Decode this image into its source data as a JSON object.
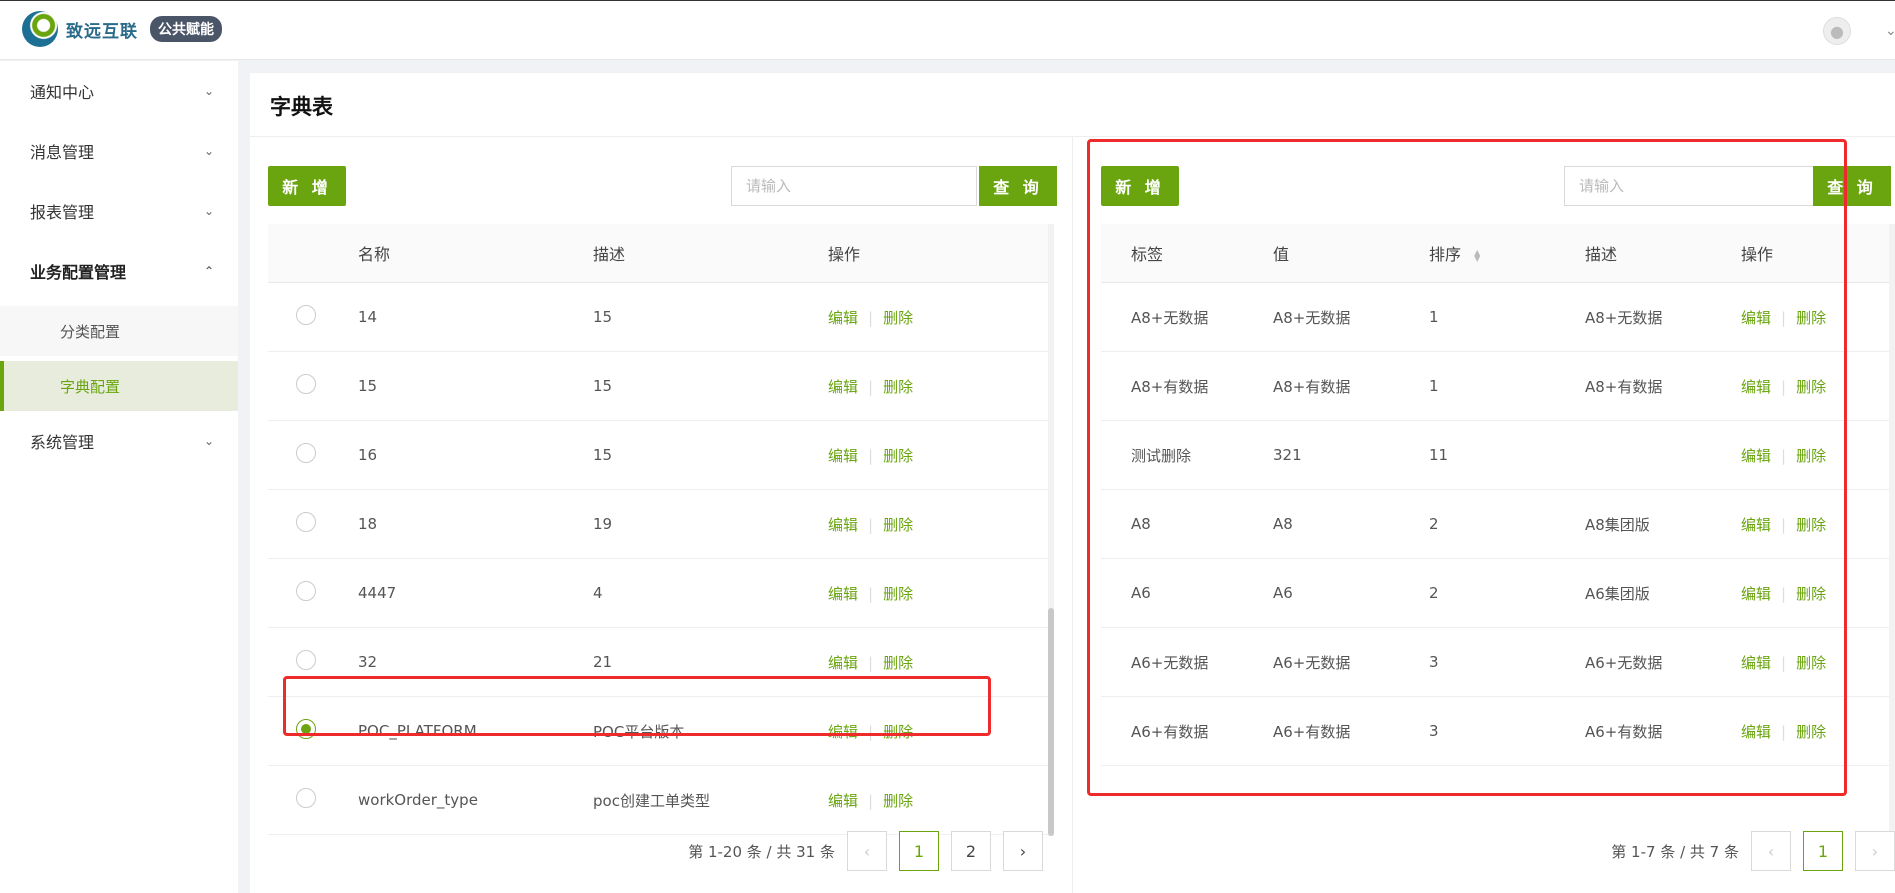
{
  "header": {
    "brand_name": "致远互联",
    "brand_badge": "公共赋能"
  },
  "sidebar": {
    "items": [
      {
        "label": "通知中心"
      },
      {
        "label": "消息管理"
      },
      {
        "label": "报表管理"
      },
      {
        "label": "业务配置管理"
      },
      {
        "label": "系统管理"
      }
    ],
    "sub_items": [
      {
        "label": "分类配置"
      },
      {
        "label": "字典配置"
      }
    ]
  },
  "page": {
    "title": "字典表"
  },
  "left_panel": {
    "add_label": "新 增",
    "search_placeholder": "请输入",
    "query_label": "查 询",
    "columns": [
      "名称",
      "描述",
      "操作"
    ],
    "rows": [
      {
        "name": "14",
        "desc": "15",
        "selected": false
      },
      {
        "name": "15",
        "desc": "15",
        "selected": false
      },
      {
        "name": "16",
        "desc": "15",
        "selected": false
      },
      {
        "name": "18",
        "desc": "19",
        "selected": false
      },
      {
        "name": "4447",
        "desc": "4",
        "selected": false
      },
      {
        "name": "32",
        "desc": "21",
        "selected": false
      },
      {
        "name": "POC_PLATFORM",
        "desc": "POC平台版本",
        "selected": true
      },
      {
        "name": "workOrder_type",
        "desc": "poc创建工单类型",
        "selected": false
      }
    ],
    "edit_label": "编辑",
    "delete_label": "删除",
    "pager": {
      "summary": "第 1-20 条 / 共 31 条",
      "pages": [
        "1",
        "2"
      ],
      "current": "1"
    }
  },
  "right_panel": {
    "add_label": "新 增",
    "search_placeholder": "请输入",
    "query_label": "查 询",
    "columns": [
      "标签",
      "值",
      "排序",
      "描述",
      "操作"
    ],
    "rows": [
      {
        "label": "A8+无数据",
        "value": "A8+无数据",
        "sort": "1",
        "desc": "A8+无数据"
      },
      {
        "label": "A8+有数据",
        "value": "A8+有数据",
        "sort": "1",
        "desc": "A8+有数据"
      },
      {
        "label": "测试删除",
        "value": "321",
        "sort": "11",
        "desc": ""
      },
      {
        "label": "A8",
        "value": "A8",
        "sort": "2",
        "desc": "A8集团版"
      },
      {
        "label": "A6",
        "value": "A6",
        "sort": "2",
        "desc": "A6集团版"
      },
      {
        "label": "A6+无数据",
        "value": "A6+无数据",
        "sort": "3",
        "desc": "A6+无数据"
      },
      {
        "label": "A6+有数据",
        "value": "A6+有数据",
        "sort": "3",
        "desc": "A6+有数据"
      }
    ],
    "edit_label": "编辑",
    "delete_label": "删除",
    "pager": {
      "summary": "第 1-7 条 / 共 7 条",
      "pages": [
        "1"
      ],
      "current": "1"
    }
  },
  "colors": {
    "accent": "#6aa510",
    "highlight": "#ee2a2a"
  }
}
